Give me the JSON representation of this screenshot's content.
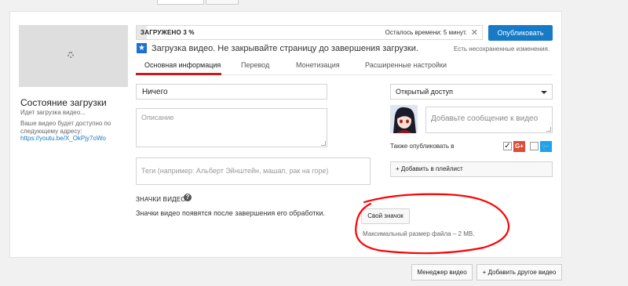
{
  "upload": {
    "progress_label": "ЗАГРУЖЕНО 3 %",
    "progress_percent": 3,
    "time_left": "Осталось времени: 5 минут.",
    "notice": "Загрузка видео. Не закрывайте страницу до завершения загрузки.",
    "publish_label": "Опубликовать",
    "unsaved": "Есть несохраненные изменения."
  },
  "status": {
    "title": "Состояние загрузки",
    "sub": "Идет загрузка видео...",
    "desc": "Ваше видео будет доступно по следующему адресу:",
    "link": "https://youtu.be/X_OkPjy7oWo"
  },
  "tabs": [
    {
      "label": "Основная информация",
      "active": true
    },
    {
      "label": "Перевод",
      "active": false
    },
    {
      "label": "Монетизация",
      "active": false
    },
    {
      "label": "Расширенные настройки",
      "active": false
    }
  ],
  "form": {
    "title_value": "Ничего",
    "description_placeholder": "Описание",
    "tags_placeholder": "Теги (например: Альберт Эйнштейн, машап, рак на горе)",
    "access_value": "Открытый доступ",
    "message_placeholder": "Добавьте сообщение к видео",
    "also_publish": "Также опубликовать в",
    "playlist_label": "+ Добавить в плейлист"
  },
  "thumbnails": {
    "title": "ЗНАЧКИ ВИДЕО",
    "help": "?",
    "message": "Значки видео появятся после завершения его обработки.",
    "custom_button": "Свой значок",
    "max_size": "Максимальный размер файла – 2 MB."
  },
  "footer": {
    "manager_label": "Менеджер видео",
    "add_label": "+ Добавить другое видео"
  },
  "share": {
    "google_plus": "G+",
    "twitter": "🐦",
    "check": "✓"
  },
  "colors": {
    "accent": "#167ac6",
    "tab_active": "#cc181e",
    "annotation": "#ff0000",
    "gplus": "#dd4b39",
    "twitter": "#1da1f2"
  }
}
